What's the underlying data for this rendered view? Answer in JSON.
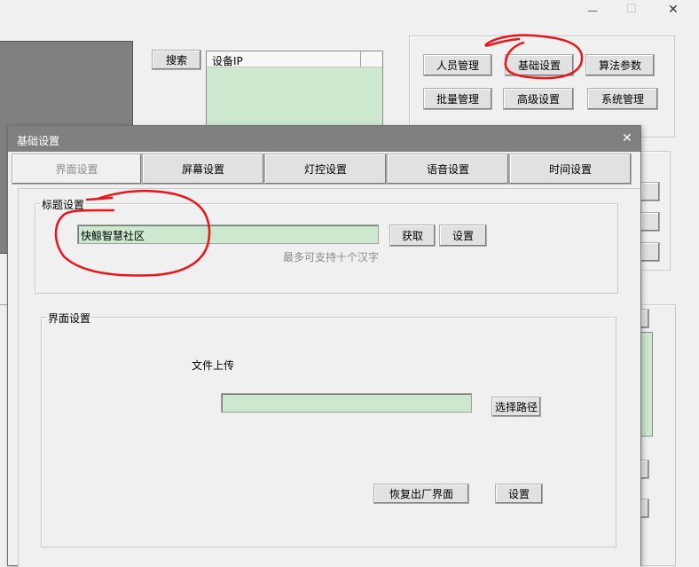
{
  "main_window": {
    "controls": {
      "minimize": "—",
      "maximize": "☐",
      "close": "✕"
    },
    "search_button": "搜索",
    "device_list": {
      "header": "设备IP"
    },
    "top_buttons": {
      "person": "人员管理",
      "basic": "基础设置",
      "algo": "算法参数",
      "batch": "批量管理",
      "advanced": "高级设置",
      "system": "系统管理"
    }
  },
  "dialog": {
    "title": "基础设置",
    "close": "✕",
    "tabs": [
      {
        "label": "界面设置",
        "active": true
      },
      {
        "label": "屏幕设置",
        "active": false
      },
      {
        "label": "灯控设置",
        "active": false
      },
      {
        "label": "语音设置",
        "active": false
      },
      {
        "label": "时间设置",
        "active": false
      }
    ],
    "title_group": {
      "legend": "标题设置",
      "value": "快鲸智慧社区",
      "get_button": "获取",
      "set_button": "设置",
      "hint": "最多可支持十个汉字"
    },
    "ui_group": {
      "legend": "界面设置",
      "upload_label": "文件上传",
      "path_value": "",
      "choose_path_button": "选择路径",
      "restore_button": "恢复出厂界面",
      "set_button": "设置"
    }
  },
  "colors": {
    "annotation": "#e8161a",
    "input_bg": "#cce8cf",
    "dialog_title_bar": "#808080"
  }
}
